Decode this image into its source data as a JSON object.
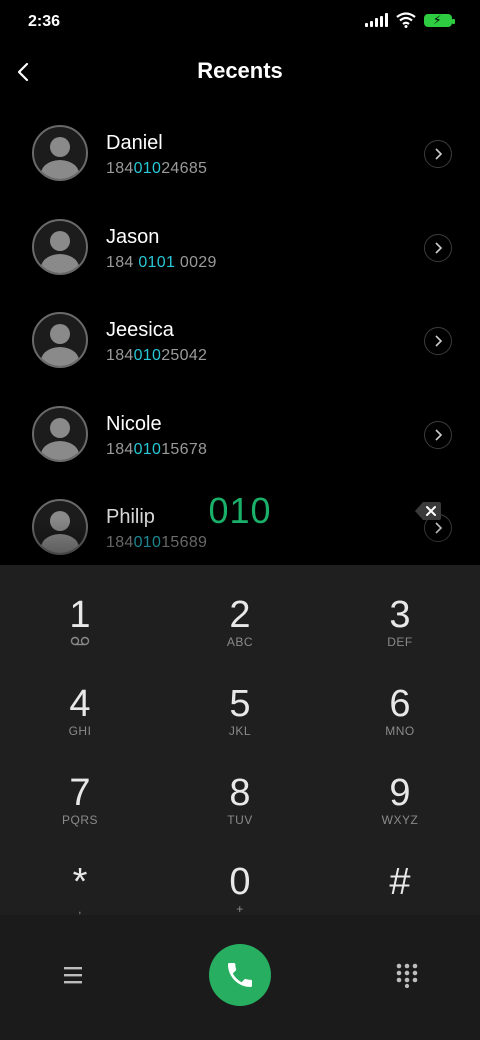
{
  "status": {
    "time": "2:36"
  },
  "header": {
    "title": "Recents"
  },
  "contacts": [
    {
      "name": "Daniel",
      "pre": "184",
      "hl": "010",
      "post": "24685"
    },
    {
      "name": "Jason",
      "pre": "184 ",
      "hl": "0101",
      "post": " 0029"
    },
    {
      "name": "Jeesica",
      "pre": "184",
      "hl": "010",
      "post": "25042"
    },
    {
      "name": "Nicole",
      "pre": "184",
      "hl": "010",
      "post": "15678"
    },
    {
      "name": "Philip",
      "pre": "184",
      "hl": "010",
      "post": "15689"
    }
  ],
  "dialed": "010",
  "keys": [
    {
      "digit": "1",
      "letters": ""
    },
    {
      "digit": "2",
      "letters": "ABC"
    },
    {
      "digit": "3",
      "letters": "DEF"
    },
    {
      "digit": "4",
      "letters": "GHI"
    },
    {
      "digit": "5",
      "letters": "JKL"
    },
    {
      "digit": "6",
      "letters": "MNO"
    },
    {
      "digit": "7",
      "letters": "PQRS"
    },
    {
      "digit": "8",
      "letters": "TUV"
    },
    {
      "digit": "9",
      "letters": "WXYZ"
    },
    {
      "digit": "*",
      "letters": ","
    },
    {
      "digit": "0",
      "letters": "+"
    },
    {
      "digit": "#",
      "letters": ""
    }
  ],
  "icons": {
    "back": "chevron-left-icon",
    "voicemail": "voicemail-icon",
    "menu": "menu-icon",
    "call": "phone-icon",
    "keypad": "dialpad-icon",
    "delete": "backspace-icon"
  },
  "colors": {
    "highlight": "#28c8d8",
    "dialed": "#1ab06a",
    "call": "#27ae60"
  }
}
